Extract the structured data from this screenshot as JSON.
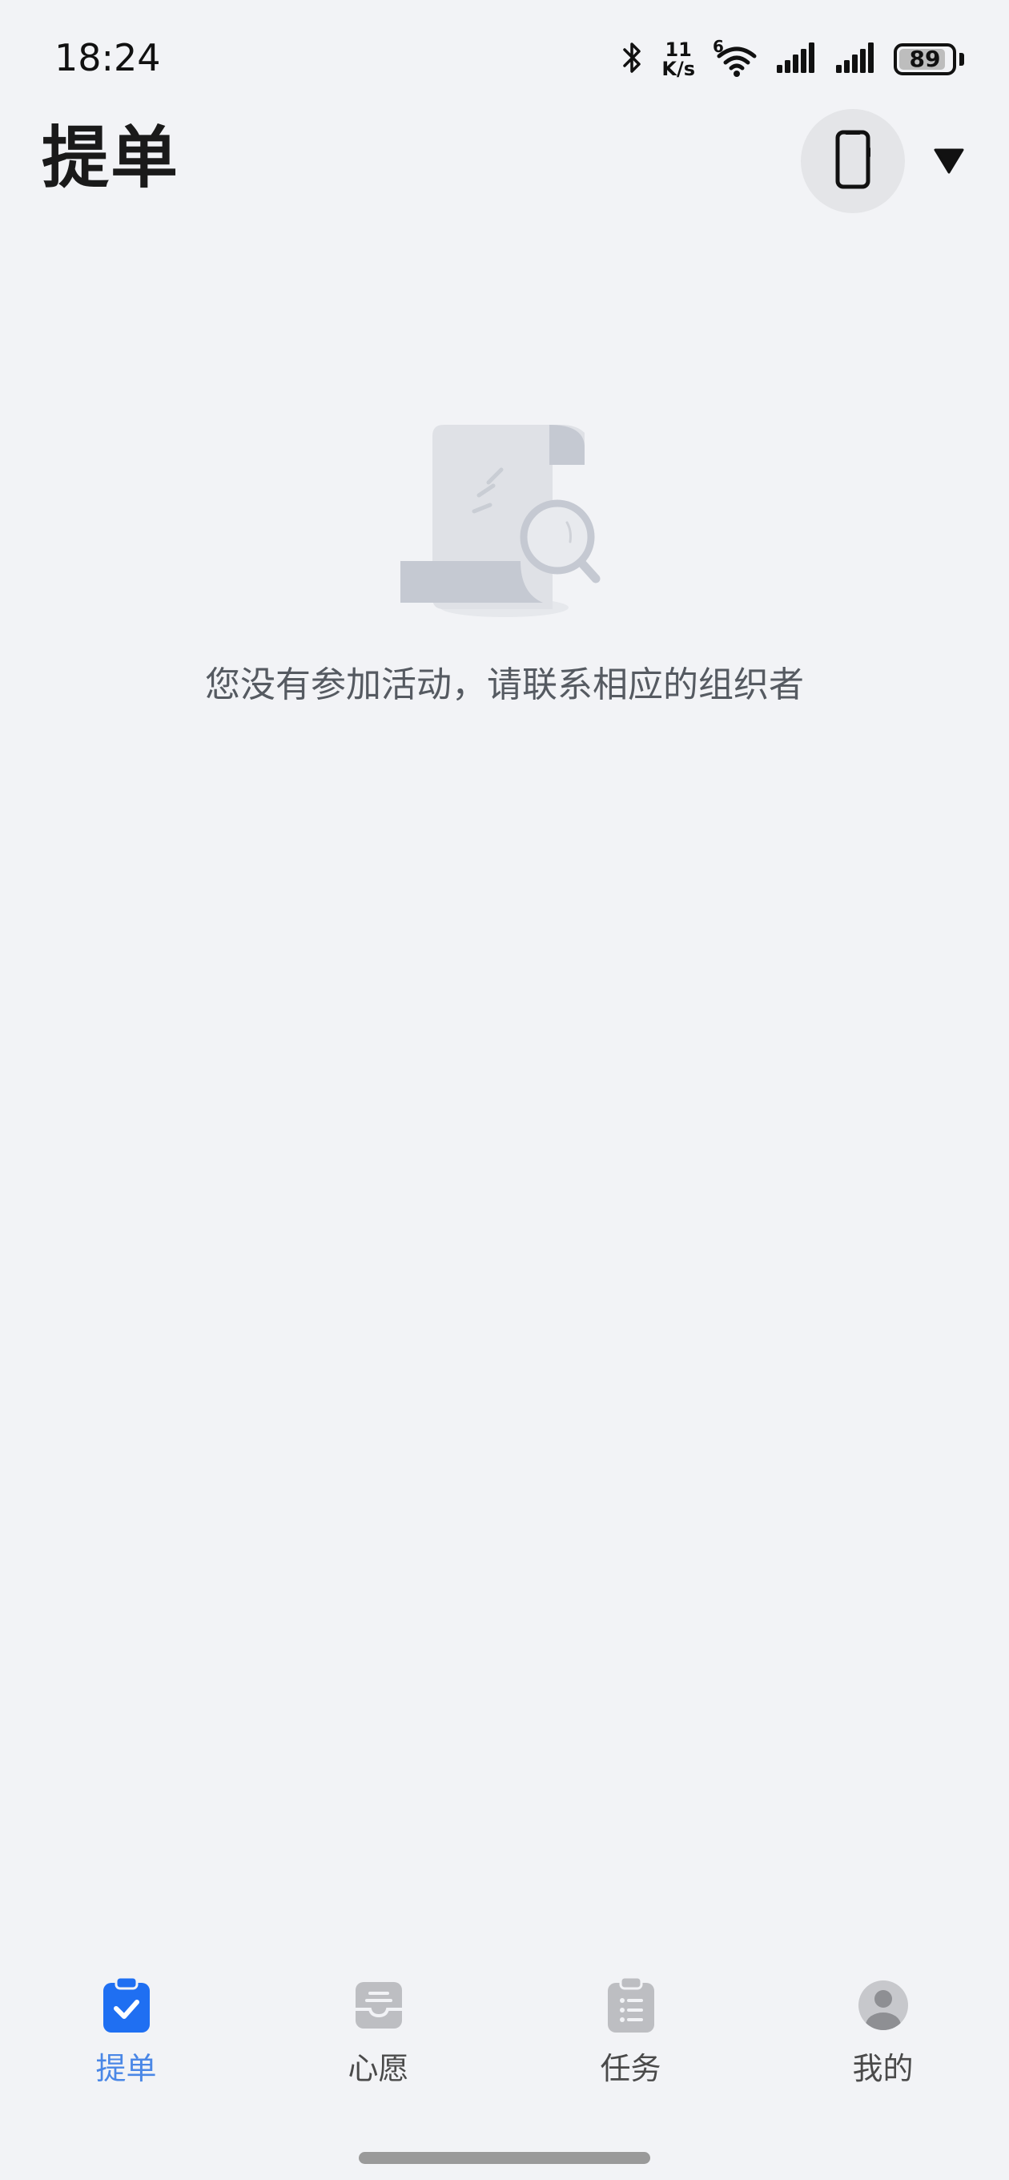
{
  "status_bar": {
    "time": "18:24",
    "net_speed_value": "11",
    "net_speed_unit": "K/s",
    "wifi_badge": "6",
    "battery_level": "89",
    "battery_fraction": 0.89
  },
  "header": {
    "title": "提单",
    "device_icon": "phone-icon",
    "dropdown_icon": "triangle-down-icon"
  },
  "empty_state": {
    "illustration": "document-search-illustration",
    "message": "您没有参加活动，请联系相应的组织者"
  },
  "bottom_nav": {
    "items": [
      {
        "label": "提单",
        "icon": "clipboard-check-icon",
        "active": true
      },
      {
        "label": "心愿",
        "icon": "inbox-tray-icon",
        "active": false
      },
      {
        "label": "任务",
        "icon": "task-list-icon",
        "active": false
      },
      {
        "label": "我的",
        "icon": "user-avatar-icon",
        "active": false
      }
    ]
  },
  "colors": {
    "background": "#f2f3f6",
    "accent": "#1f6ff2",
    "active_label": "#4a87e6",
    "inactive_icon": "#bdbec2",
    "text_secondary": "#555a61"
  }
}
